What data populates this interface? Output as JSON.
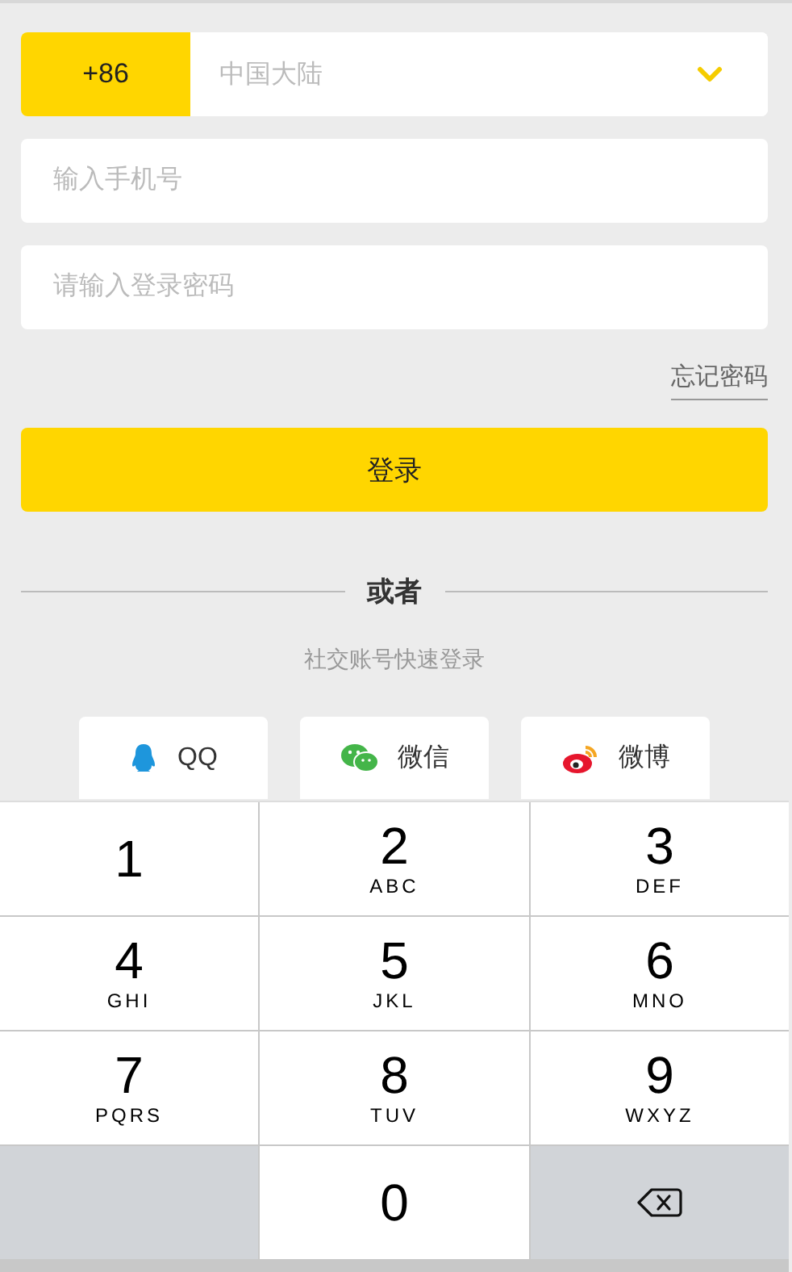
{
  "country": {
    "code": "+86",
    "name": "中国大陆"
  },
  "phone_field": {
    "placeholder": "输入手机号"
  },
  "password_field": {
    "placeholder": "请输入登录密码"
  },
  "forgot_link": "忘记密码",
  "login_button": "登录",
  "divider_label": "或者",
  "social_caption": "社交账号快速登录",
  "social_buttons": [
    {
      "kind": "qq",
      "label": "QQ"
    },
    {
      "kind": "wechat",
      "label": "微信"
    },
    {
      "kind": "weibo",
      "label": "微博"
    }
  ],
  "keypad": [
    {
      "kind": "digit",
      "digit": "1"
    },
    {
      "kind": "digit",
      "digit": "2",
      "letters": "ABC"
    },
    {
      "kind": "digit",
      "digit": "3",
      "letters": "DEF"
    },
    {
      "kind": "digit",
      "digit": "4",
      "letters": "GHI"
    },
    {
      "kind": "digit",
      "digit": "5",
      "letters": "JKL"
    },
    {
      "kind": "digit",
      "digit": "6",
      "letters": "MNO"
    },
    {
      "kind": "digit",
      "digit": "7",
      "letters": "PQRS"
    },
    {
      "kind": "digit",
      "digit": "8",
      "letters": "TUV"
    },
    {
      "kind": "digit",
      "digit": "9",
      "letters": "WXYZ"
    },
    {
      "kind": "blank"
    },
    {
      "kind": "digit",
      "digit": "0"
    },
    {
      "kind": "delete"
    }
  ]
}
